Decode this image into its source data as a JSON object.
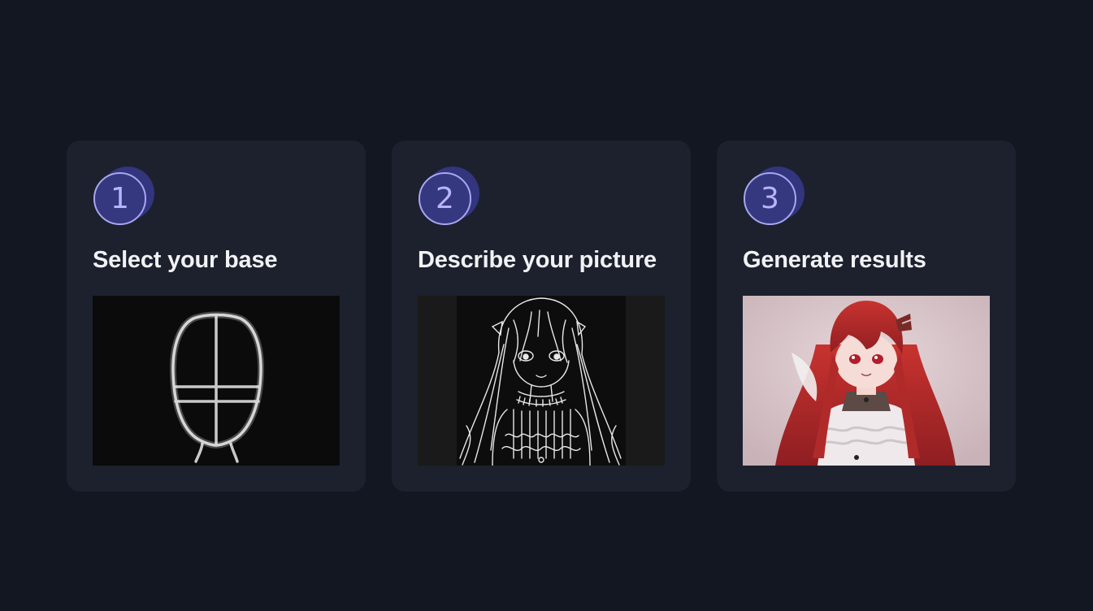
{
  "steps": [
    {
      "number": "1",
      "title": "Select your base",
      "image": "head-sketch-outline"
    },
    {
      "number": "2",
      "title": "Describe your picture",
      "image": "anime-girl-lineart"
    },
    {
      "number": "3",
      "title": "Generate results",
      "image": "anime-girl-red-hair-render"
    }
  ],
  "colors": {
    "page_background": "#131722",
    "card_background": "#1c212d",
    "badge_fill": "#35387f",
    "badge_ring": "#a9a6f2",
    "badge_text": "#b7b4fb",
    "title_text": "#f1f2f5"
  }
}
